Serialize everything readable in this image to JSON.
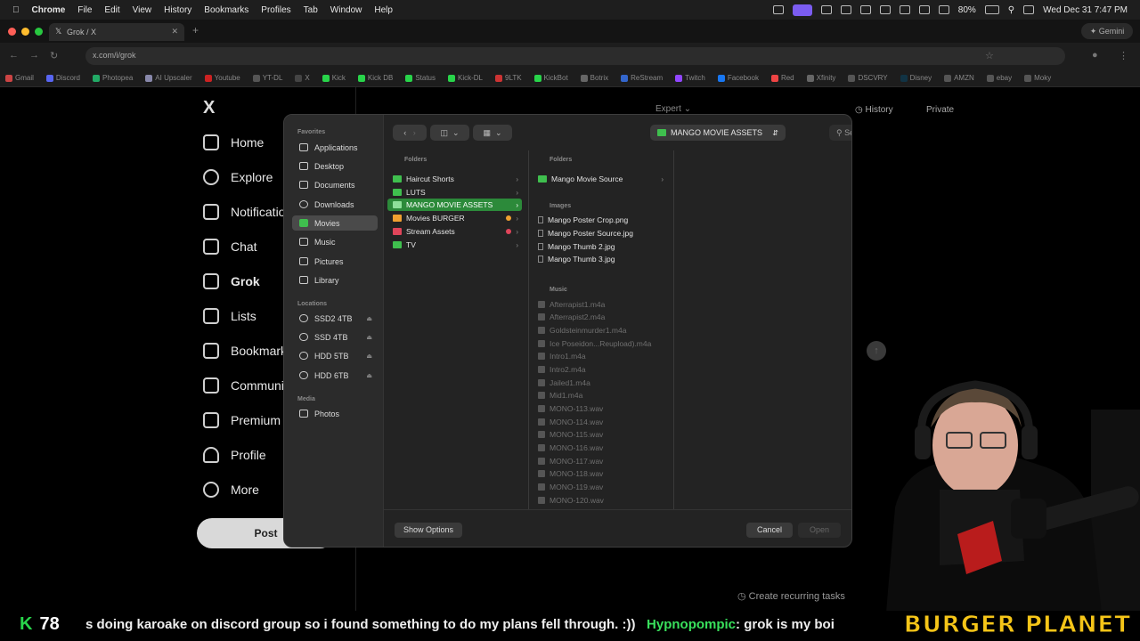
{
  "menubar": {
    "app": "Chrome",
    "items": [
      "File",
      "Edit",
      "View",
      "History",
      "Bookmarks",
      "Profiles",
      "Tab",
      "Window",
      "Help"
    ],
    "battery": "80%",
    "clock": "Wed Dec 31  7:47 PM"
  },
  "browser": {
    "tab_title": "Grok / X",
    "gemini_label": "Gemini",
    "url": "x.com/i/grok",
    "bookmarks": [
      "Gmail",
      "Discord",
      "Photopea",
      "AI Upscaler",
      "Youtube",
      "YT-DL",
      "X",
      "Kick",
      "Kick DB",
      "Status",
      "Kick-DL",
      "9LTK",
      "KickBot",
      "Botrix",
      "ReStream",
      "Twitch",
      "Facebook",
      "Red",
      "Xfinity",
      "DSCVRY",
      "Disney",
      "AMZN",
      "ebay",
      "Moky"
    ]
  },
  "x_sidebar": {
    "logo": "X",
    "items": [
      "Home",
      "Explore",
      "Notifications",
      "Chat",
      "Grok",
      "Lists",
      "Bookmarks",
      "Communities",
      "Premium",
      "Profile",
      "More"
    ],
    "post": "Post"
  },
  "grok": {
    "expert": "Expert",
    "history": "History",
    "private": "Private",
    "recurring": "Create recurring tasks"
  },
  "dialog": {
    "sidebar": {
      "favorites_head": "Favorites",
      "favorites": [
        "Applications",
        "Desktop",
        "Documents",
        "Downloads",
        "Movies",
        "Music",
        "Pictures",
        "Library"
      ],
      "locations_head": "Locations",
      "locations": [
        "SSD2 4TB",
        "SSD 4TB",
        "HDD 5TB",
        "HDD 6TB"
      ],
      "media_head": "Media",
      "media": [
        "Photos"
      ]
    },
    "location": "MANGO MOVIE ASSETS",
    "search_placeholder": "Search",
    "col1": {
      "head": "Folders",
      "items": [
        "Haircut Shorts",
        "LUTS",
        "MANGO MOVIE ASSETS",
        "Movies BURGER",
        "Stream Assets",
        "TV"
      ]
    },
    "col2": {
      "folders_head": "Folders",
      "folders": [
        "Mango Movie Source"
      ],
      "images_head": "Images",
      "images": [
        "Mango Poster Crop.png",
        "Mango Poster Source.jpg",
        "Mango Thumb 2.jpg",
        "Mango Thumb 3.jpg"
      ],
      "music_head": "Music",
      "music": [
        "Afterrapist1.m4a",
        "Afterrapist2.m4a",
        "Goldsteinmurder1.m4a",
        "Ice Poseidon...Reupload).m4a",
        "Intro1.m4a",
        "Intro2.m4a",
        "Jailed1.m4a",
        "Mid1.m4a",
        "MONO-113.wav",
        "MONO-114.wav",
        "MONO-115.wav",
        "MONO-116.wav",
        "MONO-117.wav",
        "MONO-118.wav",
        "MONO-119.wav",
        "MONO-120.wav"
      ]
    },
    "show_options": "Show Options",
    "cancel": "Cancel",
    "open": "Open",
    "colors": {
      "folder_green": "#3fbf4e",
      "folder_orange": "#f0a030",
      "folder_red": "#e0455a",
      "selection": "#2c8a3a"
    }
  },
  "stream": {
    "kick_count": "78",
    "message": "s doing karoake on discord group so i found something to do my plans fell through. :))",
    "chat_user": "Hypnopompic",
    "chat_text": ": grok is my boi",
    "banner": "BURGER PLANET"
  }
}
